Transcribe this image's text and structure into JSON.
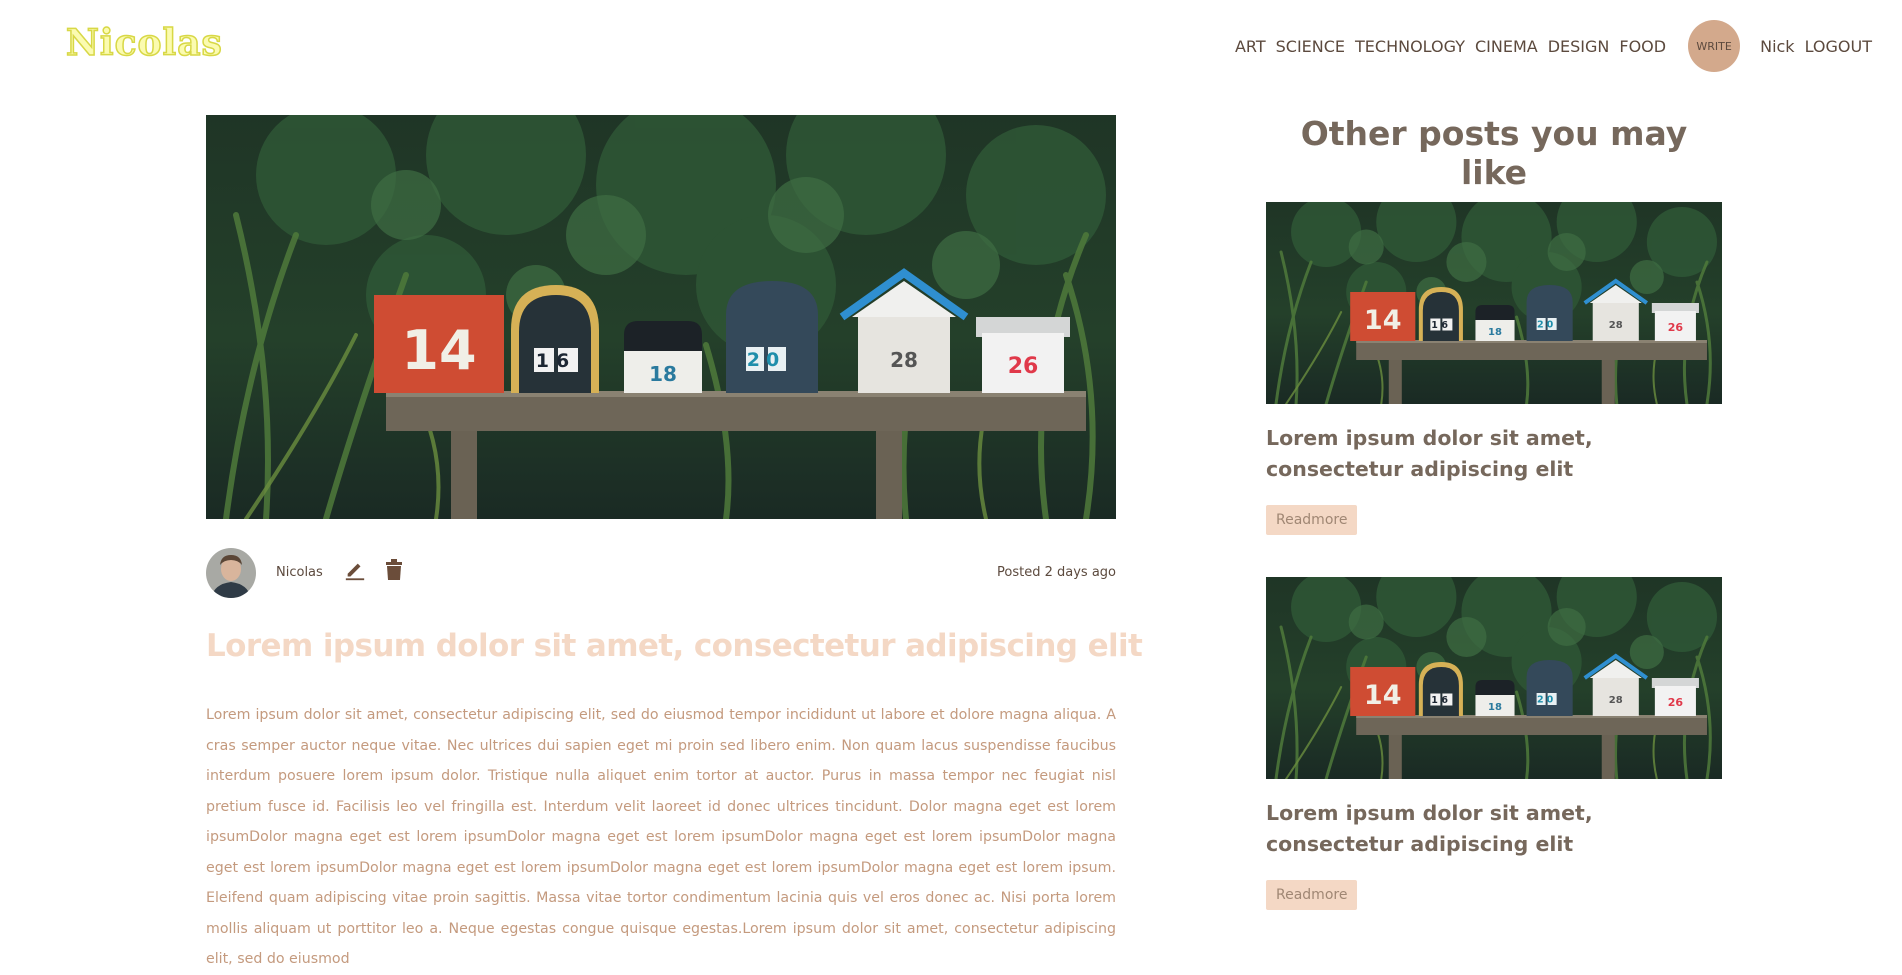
{
  "brand": {
    "logo": "Nicolas"
  },
  "nav": {
    "categories": [
      "ART",
      "SCIENCE",
      "TECHNOLOGY",
      "CINEMA",
      "DESIGN",
      "FOOD"
    ],
    "write_label": "WRITE",
    "user": "Nick",
    "logout": "LOGOUT"
  },
  "post": {
    "author": "Nicolas",
    "posted": "Posted 2 days ago",
    "title": "Lorem ipsum dolor sit amet, consectetur adipiscing elit",
    "body": "Lorem ipsum dolor sit amet, consectetur adipiscing elit, sed do eiusmod tempor incididunt ut labore et dolore magna aliqua. A cras semper auctor neque vitae. Nec ultrices dui sapien eget mi proin sed libero enim. Non quam lacus suspendisse faucibus interdum posuere lorem ipsum dolor. Tristique nulla aliquet enim tortor at auctor. Purus in massa tempor nec feugiat nisl pretium fusce id. Facilisis leo vel fringilla est. Interdum velit laoreet id donec ultrices tincidunt. Dolor magna eget est lorem ipsumDolor magna eget est lorem ipsumDolor magna eget est lorem ipsumDolor magna eget est lorem ipsumDolor magna eget est lorem ipsumDolor magna eget est lorem ipsumDolor magna eget est lorem ipsumDolor magna eget est lorem ipsum. Eleifend quam adipiscing vitae proin sagittis. Massa vitae tortor condimentum lacinia quis vel eros donec ac. Nisi porta lorem mollis aliquam ut porttitor leo a. Neque egestas congue quisque egestas.Lorem ipsum dolor sit amet, consectetur adipiscing elit, sed do eiusmod"
  },
  "sidebar": {
    "heading": "Other posts you may like",
    "cards": [
      {
        "title": "Lorem ipsum dolor sit amet, consectetur adipiscing elit",
        "button": "Readmore"
      },
      {
        "title": "Lorem ipsum dolor sit amet, consectetur adipiscing elit",
        "button": "Readmore"
      }
    ]
  },
  "mailbox_numbers": [
    "14",
    "16",
    "18",
    "20",
    "28",
    "26"
  ],
  "icons": {
    "edit": "pencil-icon",
    "delete": "trash-icon"
  },
  "colors": {
    "text": "#5c4a3e",
    "accent": "#d3a98c",
    "title_light": "#f4d8c5",
    "body_text": "#c49a7e",
    "sidebar_text": "#76685c",
    "logo_fill": "#fbfbb0",
    "logo_stroke": "#d8d846"
  }
}
